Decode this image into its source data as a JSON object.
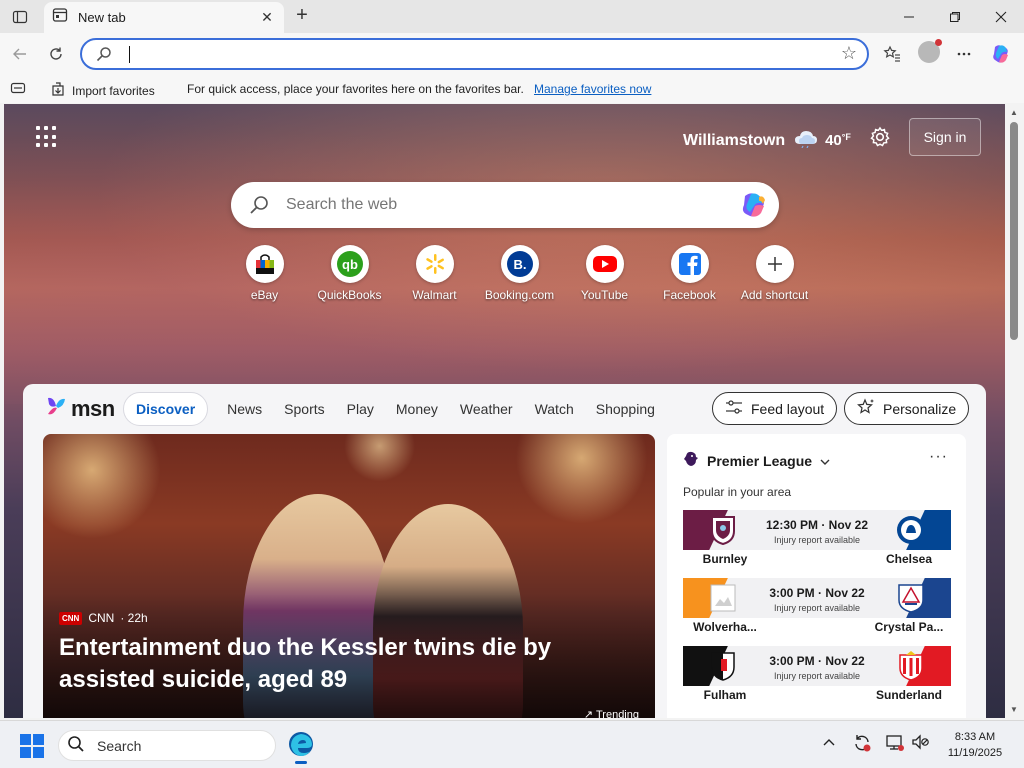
{
  "tab": {
    "title": "New tab",
    "close": "✕"
  },
  "newtab": "+",
  "address": {
    "value": ""
  },
  "favbar": {
    "import_label": "Import favorites",
    "hint": "For quick access, place your favorites here on the favorites bar.",
    "manage_link": "Manage favorites now"
  },
  "header": {
    "city": "Williamstown",
    "temp": "40",
    "temp_unit": "°F",
    "signin": "Sign in"
  },
  "websearch": {
    "placeholder": "Search the web"
  },
  "shortcuts": [
    {
      "label": "eBay"
    },
    {
      "label": "QuickBooks"
    },
    {
      "label": "Walmart"
    },
    {
      "label": "Booking.com"
    },
    {
      "label": "YouTube"
    },
    {
      "label": "Facebook"
    },
    {
      "label": "Add shortcut"
    }
  ],
  "feed": {
    "brand": "msn",
    "tabs": [
      "Discover",
      "News",
      "Sports",
      "Play",
      "Money",
      "Weather",
      "Watch",
      "Shopping"
    ],
    "feed_layout": "Feed layout",
    "personalize": "Personalize"
  },
  "hero": {
    "source": "CNN",
    "source_badge": "CNN",
    "age": "· 22h",
    "headline": "Entertainment duo the Kessler twins die by assisted suicide, aged 89",
    "trending": "↗ Trending"
  },
  "widget": {
    "league": "Premier League",
    "more": "···",
    "subtitle": "Popular in your area",
    "matches": [
      {
        "home": "Burnley",
        "away": "Chelsea",
        "time": "12:30 PM · Nov 22",
        "note": "Injury report available",
        "home_color": "#6c1d45",
        "away_color": "#034694"
      },
      {
        "home": "Wolverha...",
        "away": "Crystal Pa...",
        "time": "3:00 PM · Nov 22",
        "note": "Injury report available",
        "home_color": "#f7921e",
        "away_color": "#1b458f"
      },
      {
        "home": "Fulham",
        "away": "Sunderland",
        "time": "3:00 PM · Nov 22",
        "note": "Injury report available",
        "home_color": "#111111",
        "away_color": "#e21a23"
      }
    ]
  },
  "taskbar": {
    "search_label": "Search",
    "time": "8:33 AM",
    "date": "11/19/2025"
  },
  "colors": {
    "accent": "#0b5fc2",
    "address_border": "#3b6ed9"
  }
}
